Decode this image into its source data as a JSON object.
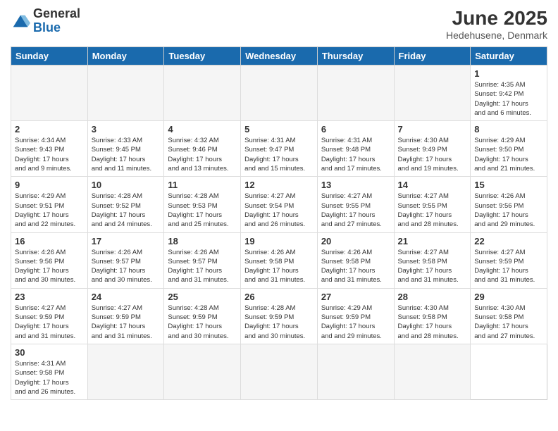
{
  "logo": {
    "general": "General",
    "blue": "Blue"
  },
  "header": {
    "title": "June 2025",
    "location": "Hedehusene, Denmark"
  },
  "weekdays": [
    "Sunday",
    "Monday",
    "Tuesday",
    "Wednesday",
    "Thursday",
    "Friday",
    "Saturday"
  ],
  "days": [
    {
      "num": "",
      "empty": true
    },
    {
      "num": "",
      "empty": true
    },
    {
      "num": "",
      "empty": true
    },
    {
      "num": "",
      "empty": true
    },
    {
      "num": "",
      "empty": true
    },
    {
      "num": "",
      "empty": true
    },
    {
      "num": "1",
      "sunrise": "4:35 AM",
      "sunset": "9:42 PM",
      "daylight": "17 hours and 6 minutes."
    },
    {
      "num": "2",
      "sunrise": "4:34 AM",
      "sunset": "9:43 PM",
      "daylight": "17 hours and 9 minutes."
    },
    {
      "num": "3",
      "sunrise": "4:33 AM",
      "sunset": "9:45 PM",
      "daylight": "17 hours and 11 minutes."
    },
    {
      "num": "4",
      "sunrise": "4:32 AM",
      "sunset": "9:46 PM",
      "daylight": "17 hours and 13 minutes."
    },
    {
      "num": "5",
      "sunrise": "4:31 AM",
      "sunset": "9:47 PM",
      "daylight": "17 hours and 15 minutes."
    },
    {
      "num": "6",
      "sunrise": "4:31 AM",
      "sunset": "9:48 PM",
      "daylight": "17 hours and 17 minutes."
    },
    {
      "num": "7",
      "sunrise": "4:30 AM",
      "sunset": "9:49 PM",
      "daylight": "17 hours and 19 minutes."
    },
    {
      "num": "8",
      "sunrise": "4:29 AM",
      "sunset": "9:50 PM",
      "daylight": "17 hours and 21 minutes."
    },
    {
      "num": "9",
      "sunrise": "4:29 AM",
      "sunset": "9:51 PM",
      "daylight": "17 hours and 22 minutes."
    },
    {
      "num": "10",
      "sunrise": "4:28 AM",
      "sunset": "9:52 PM",
      "daylight": "17 hours and 24 minutes."
    },
    {
      "num": "11",
      "sunrise": "4:28 AM",
      "sunset": "9:53 PM",
      "daylight": "17 hours and 25 minutes."
    },
    {
      "num": "12",
      "sunrise": "4:27 AM",
      "sunset": "9:54 PM",
      "daylight": "17 hours and 26 minutes."
    },
    {
      "num": "13",
      "sunrise": "4:27 AM",
      "sunset": "9:55 PM",
      "daylight": "17 hours and 27 minutes."
    },
    {
      "num": "14",
      "sunrise": "4:27 AM",
      "sunset": "9:55 PM",
      "daylight": "17 hours and 28 minutes."
    },
    {
      "num": "15",
      "sunrise": "4:26 AM",
      "sunset": "9:56 PM",
      "daylight": "17 hours and 29 minutes."
    },
    {
      "num": "16",
      "sunrise": "4:26 AM",
      "sunset": "9:56 PM",
      "daylight": "17 hours and 30 minutes."
    },
    {
      "num": "17",
      "sunrise": "4:26 AM",
      "sunset": "9:57 PM",
      "daylight": "17 hours and 30 minutes."
    },
    {
      "num": "18",
      "sunrise": "4:26 AM",
      "sunset": "9:57 PM",
      "daylight": "17 hours and 31 minutes."
    },
    {
      "num": "19",
      "sunrise": "4:26 AM",
      "sunset": "9:58 PM",
      "daylight": "17 hours and 31 minutes."
    },
    {
      "num": "20",
      "sunrise": "4:26 AM",
      "sunset": "9:58 PM",
      "daylight": "17 hours and 31 minutes."
    },
    {
      "num": "21",
      "sunrise": "4:27 AM",
      "sunset": "9:58 PM",
      "daylight": "17 hours and 31 minutes."
    },
    {
      "num": "22",
      "sunrise": "4:27 AM",
      "sunset": "9:59 PM",
      "daylight": "17 hours and 31 minutes."
    },
    {
      "num": "23",
      "sunrise": "4:27 AM",
      "sunset": "9:59 PM",
      "daylight": "17 hours and 31 minutes."
    },
    {
      "num": "24",
      "sunrise": "4:27 AM",
      "sunset": "9:59 PM",
      "daylight": "17 hours and 31 minutes."
    },
    {
      "num": "25",
      "sunrise": "4:28 AM",
      "sunset": "9:59 PM",
      "daylight": "17 hours and 30 minutes."
    },
    {
      "num": "26",
      "sunrise": "4:28 AM",
      "sunset": "9:59 PM",
      "daylight": "17 hours and 30 minutes."
    },
    {
      "num": "27",
      "sunrise": "4:29 AM",
      "sunset": "9:59 PM",
      "daylight": "17 hours and 29 minutes."
    },
    {
      "num": "28",
      "sunrise": "4:30 AM",
      "sunset": "9:58 PM",
      "daylight": "17 hours and 28 minutes."
    },
    {
      "num": "29",
      "sunrise": "4:30 AM",
      "sunset": "9:58 PM",
      "daylight": "17 hours and 27 minutes."
    },
    {
      "num": "30",
      "sunrise": "4:31 AM",
      "sunset": "9:58 PM",
      "daylight": "17 hours and 26 minutes."
    },
    {
      "num": "",
      "empty": true
    },
    {
      "num": "",
      "empty": true
    },
    {
      "num": "",
      "empty": true
    },
    {
      "num": "",
      "empty": true
    },
    {
      "num": "",
      "empty": true
    }
  ],
  "labels": {
    "sunrise": "Sunrise:",
    "sunset": "Sunset:",
    "daylight": "Daylight:"
  }
}
